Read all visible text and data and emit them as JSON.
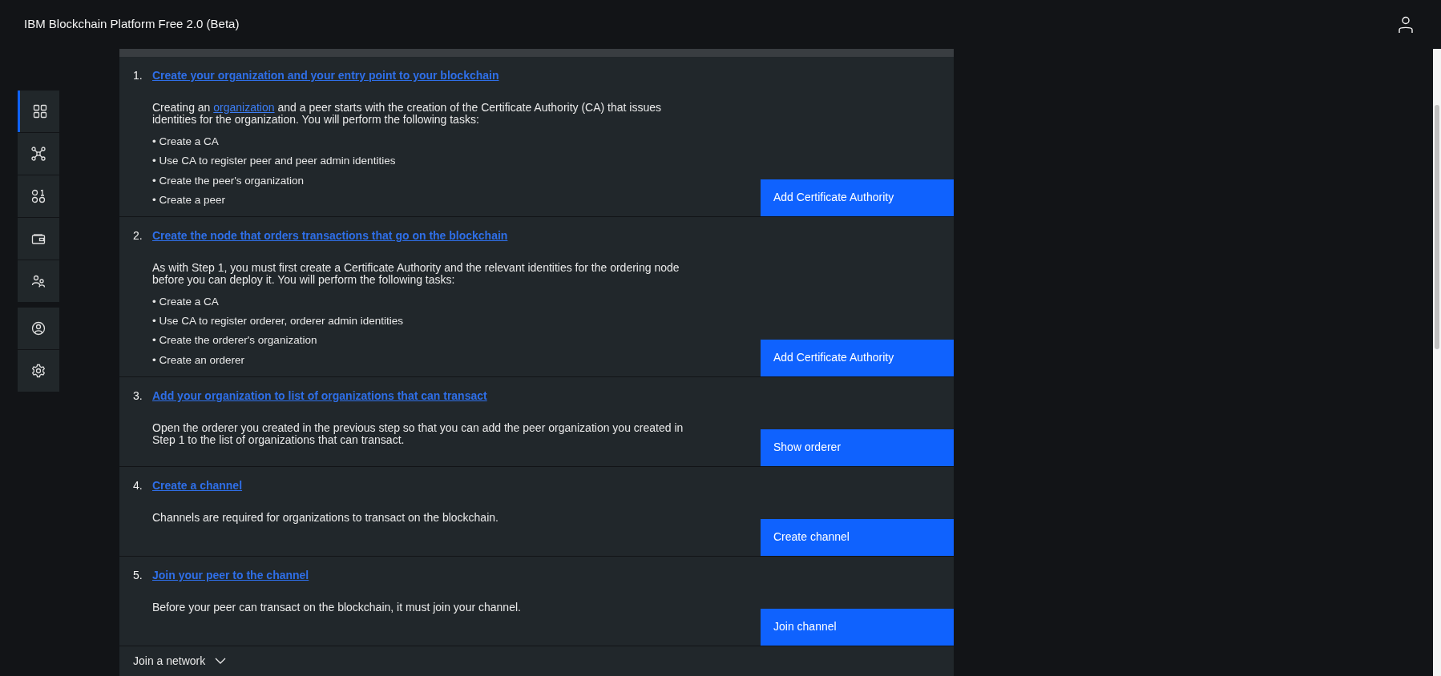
{
  "header": {
    "title": "IBM Blockchain Platform Free 2.0 (Beta)"
  },
  "sidebar": {
    "groups": [
      [
        {
          "kind": "grid",
          "selected": true
        },
        {
          "kind": "nodes",
          "selected": false
        },
        {
          "kind": "binary",
          "selected": false
        },
        {
          "kind": "wallet",
          "selected": false
        },
        {
          "kind": "users",
          "selected": false
        }
      ],
      [
        {
          "kind": "user",
          "selected": false
        },
        {
          "kind": "settings",
          "selected": false
        }
      ]
    ]
  },
  "steps": [
    {
      "number": "1.",
      "title": "Create your organization and your entry point to your blockchain",
      "description": [
        {
          "kind": "text",
          "text": "Creating an "
        },
        {
          "kind": "link",
          "text": "organization"
        },
        {
          "kind": "text",
          "text": " and a peer starts with the creation of the Certificate Authority (CA) that issues identities for the organization. You will perform the following tasks:"
        }
      ],
      "tasks": [
        "• Create a CA",
        "• Use CA to register peer and peer admin identities",
        "• Create the peer's organization",
        "• Create a peer"
      ],
      "button": "Add Certificate Authority"
    },
    {
      "number": "2.",
      "title": "Create the node that orders transactions that go on the blockchain",
      "description": [
        {
          "kind": "text",
          "text": "As with Step 1, you must first create a Certificate Authority and the relevant identities for the ordering node before you can deploy it. You will perform the following tasks:"
        }
      ],
      "tasks": [
        "• Create a CA",
        "• Use CA to register orderer, orderer admin identities",
        "• Create the orderer's organization",
        "• Create an orderer"
      ],
      "button": "Add Certificate Authority"
    },
    {
      "number": "3.",
      "title": "Add your organization to list of organizations that can transact",
      "description": [
        {
          "kind": "text",
          "text": "Open the orderer you created in the previous step so that you can add the peer organization you created in Step 1 to the list of organizations that can transact."
        }
      ],
      "button": "Show orderer"
    },
    {
      "number": "4.",
      "title": "Create a channel",
      "description": [
        {
          "kind": "text",
          "text": "Channels are required for organizations to transact on the blockchain."
        }
      ],
      "button": "Create channel"
    },
    {
      "number": "5.",
      "title": "Join your peer to the channel",
      "description": [
        {
          "kind": "text",
          "text": "Before your peer can transact on the blockchain, it must join your channel."
        }
      ],
      "button": "Join channel"
    }
  ],
  "footer_section": {
    "label": "Join a network",
    "expanded": false
  }
}
